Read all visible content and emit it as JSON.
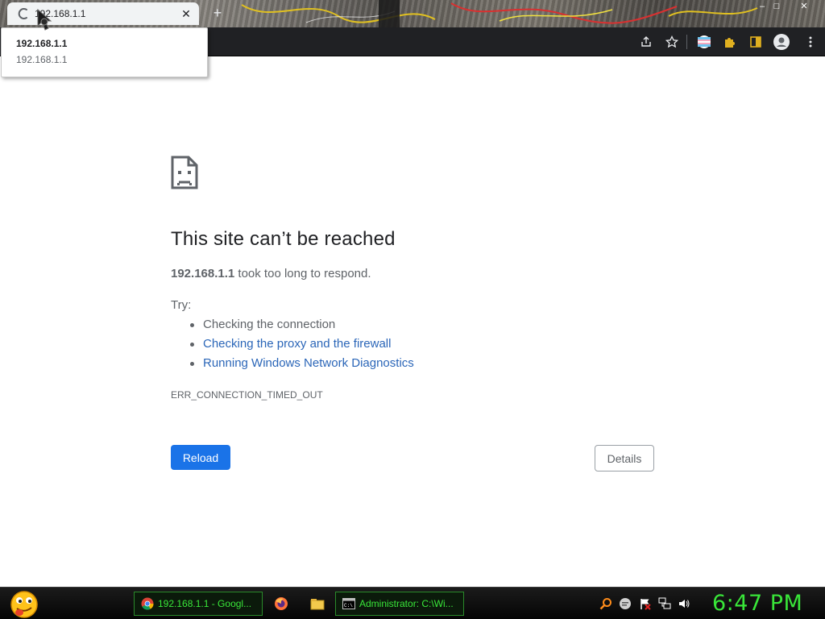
{
  "browser": {
    "tab": {
      "title": "192.168.1.1",
      "close_icon": "close-icon",
      "spinner_icon": "loading-spinner-icon"
    },
    "new_tab_label": "+",
    "window_controls": {
      "minimize": "–",
      "maximize": "□",
      "close": "✕"
    },
    "toolbar_icons": [
      "share-icon",
      "star-bookmark-icon",
      "profile-flag-icon",
      "extensions-puzzle-icon",
      "side-panel-icon",
      "account-avatar-icon"
    ],
    "hover_card": {
      "title": "192.168.1.1",
      "url": "192.168.1.1"
    }
  },
  "error_page": {
    "icon": "sad-page-icon",
    "heading": "This site can’t be reached",
    "host": "192.168.1.1",
    "summary_rest": " took too long to respond.",
    "try_label": "Try:",
    "suggestions": [
      {
        "text": "Checking the connection",
        "is_link": false
      },
      {
        "text": "Checking the proxy and the firewall",
        "is_link": true
      },
      {
        "text": "Running Windows Network Diagnostics",
        "is_link": true
      }
    ],
    "error_code": "ERR_CONNECTION_TIMED_OUT",
    "reload_label": "Reload",
    "details_label": "Details",
    "colors": {
      "primary_button": "#1a73e8",
      "link": "#2b66b8",
      "text_secondary": "#5f6368"
    }
  },
  "taskbar": {
    "start_icon": "tongue-emoji-start-icon",
    "tasks": [
      {
        "label": "192.168.1.1 - Googl...",
        "icon": "chrome-icon"
      },
      {
        "label": "Administrator: C:\\Wi...",
        "icon": "cmd-icon"
      }
    ],
    "pinned_icons": [
      "firefox-icon",
      "folder-icon"
    ],
    "tray_icons": [
      "search-icon",
      "chat-icon",
      "flag-icon",
      "network-icon",
      "volume-icon"
    ],
    "clock": "6:47 PM",
    "accent_color": "#39e639"
  }
}
